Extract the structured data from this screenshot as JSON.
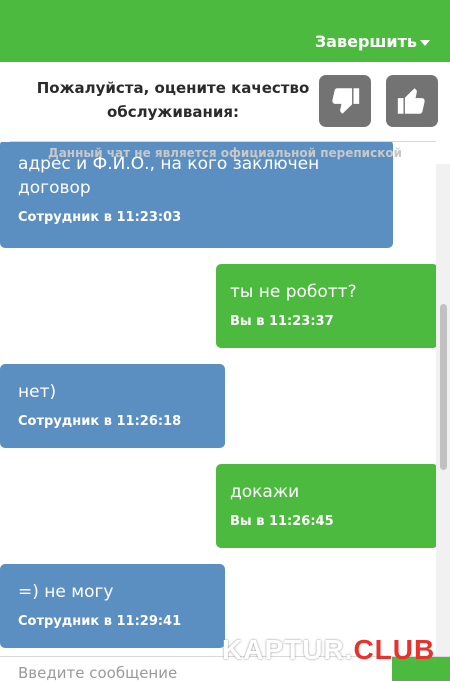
{
  "header": {
    "finish_label": "Завершить"
  },
  "rating": {
    "prompt": "Пожалуйста, оцените качество обслуживания:",
    "thumbs_down_icon": "thumbs-down-icon",
    "thumbs_up_icon": "thumbs-up-icon"
  },
  "disclaimer": "Данный чат не является официальной перепиской",
  "messages": [
    {
      "from": "operator",
      "text": "адрес и Ф.И.О., на кого заключен договор",
      "meta": "Сотрудник в 11:23:03"
    },
    {
      "from": "user",
      "text": "ты не роботт?",
      "meta": "Вы в 11:23:37"
    },
    {
      "from": "operator",
      "text": "нет)",
      "meta": "Сотрудник в 11:26:18"
    },
    {
      "from": "user",
      "text": "докажи",
      "meta": "Вы в 11:26:45"
    },
    {
      "from": "operator",
      "text": "=) не могу",
      "meta": "Сотрудник в 11:29:41"
    }
  ],
  "composer": {
    "placeholder": "Введите сообщение"
  },
  "watermark": {
    "part1": "KAPTUR.",
    "part2": "CLUB"
  },
  "colors": {
    "accent_green": "#4cba3f",
    "operator_blue": "#5b8fc2",
    "button_gray": "#737373"
  }
}
